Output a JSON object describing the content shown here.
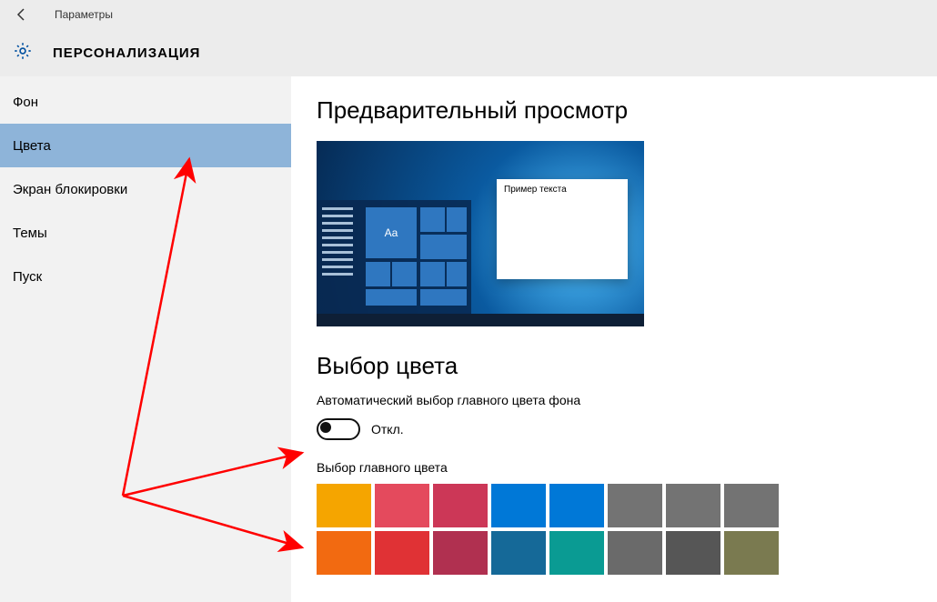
{
  "window": {
    "title": "Параметры"
  },
  "header": {
    "category": "ПЕРСОНАЛИЗАЦИЯ"
  },
  "sidebar": {
    "items": [
      {
        "label": "Фон",
        "selected": false
      },
      {
        "label": "Цвета",
        "selected": true
      },
      {
        "label": "Экран блокировки",
        "selected": false
      },
      {
        "label": "Темы",
        "selected": false
      },
      {
        "label": "Пуск",
        "selected": false
      }
    ]
  },
  "content": {
    "preview_title": "Предварительный просмотр",
    "preview_window_text": "Пример текста",
    "preview_tile_text": "Aa",
    "choose_color_title": "Выбор цвета",
    "auto_color_label": "Автоматический выбор главного цвета фона",
    "toggle_state_label": "Откл.",
    "toggle_on": false,
    "accent_label": "Выбор главного цвета",
    "swatches": [
      [
        "#f5a500",
        "#e44a5d",
        "#cc3757",
        "#0078d7",
        "#0078d7",
        "#737373",
        "#737373",
        "#737373"
      ],
      [
        "#f26a11",
        "#e03235",
        "#b03050",
        "#156998",
        "#0a9b93",
        "#6a6a6a",
        "#565656",
        "#7a7a50"
      ]
    ]
  }
}
